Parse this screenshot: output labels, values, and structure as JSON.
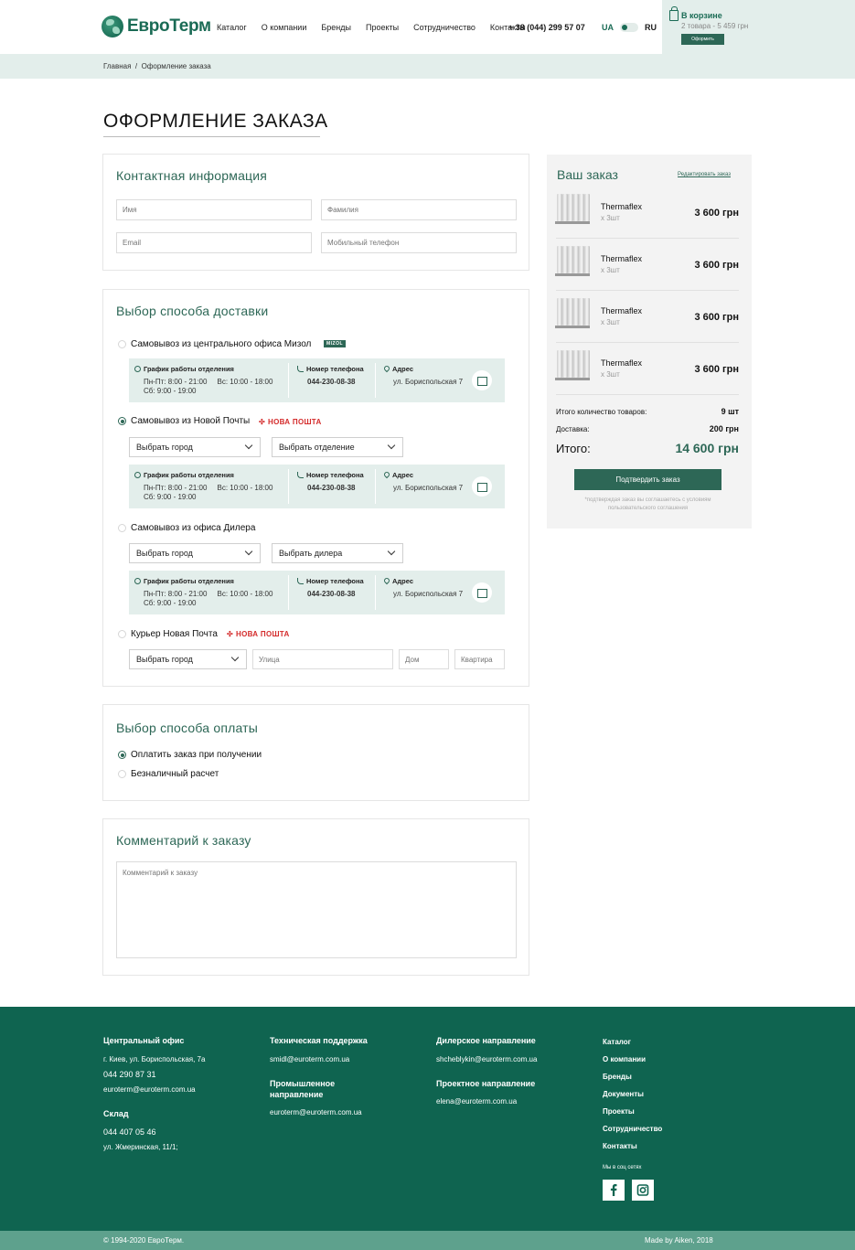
{
  "header": {
    "logo": "ЕвроТерм",
    "nav": [
      "Каталог",
      "О компании",
      "Бренды",
      "Проекты",
      "Сотрудничество",
      "Контакты"
    ],
    "phone": "+ 38 (044) 299 57 07",
    "lang_ua": "UA",
    "lang_ru": "RU",
    "cart": {
      "title": "В корзине",
      "subtitle": "2 товара - 5 459 грн",
      "button": "Оформить"
    }
  },
  "breadcrumb": {
    "home": "Главная",
    "sep": "/",
    "current": "Оформление заказа"
  },
  "page_title": "ОФОРМЛЕНИЕ ЗАКАЗА",
  "contact": {
    "title": "Контактная информация",
    "first_name": "Имя",
    "last_name": "Фамилия",
    "email": "Email",
    "phone": "Мобильный телефон"
  },
  "delivery": {
    "title": "Выбор способа доставки",
    "options": [
      {
        "label": "Самовывоз из центрального офиса Мизол",
        "badge": "MIZOL",
        "checked": false
      },
      {
        "label": "Самовывоз из Новой Почты",
        "badge": "НОВА ПОШТА",
        "checked": true,
        "select1": "Выбрать город",
        "select2": "Выбрать отделение"
      },
      {
        "label": "Самовывоз из офиса Дилера",
        "checked": false,
        "select1": "Выбрать город",
        "select2": "Выбрать дилера"
      },
      {
        "label": "Курьер Новая Почта",
        "badge": "НОВА ПОШТА",
        "checked": false,
        "select1": "Выбрать город",
        "street": "Улица",
        "house": "Дом",
        "apt": "Квартира"
      }
    ],
    "info": {
      "hours_h": "График работы отделения",
      "hours_1": "Пн-Пт: 8:00 - 21:00",
      "hours_2": "Вс: 10:00 - 18:00",
      "hours_3": "Сб: 9:00 - 19:00",
      "phone_h": "Номер телефона",
      "phone_v": "044-230-08-38",
      "addr_h": "Адрес",
      "addr_v": "ул. Бориспольская 7"
    }
  },
  "payment": {
    "title": "Выбор способа оплаты",
    "opt1": "Оплатить заказ при получении",
    "opt2": "Безналичный расчет"
  },
  "comment": {
    "title": "Комментарий к заказу",
    "placeholder": "Комментарий к заказу"
  },
  "order": {
    "title": "Ваш заказ",
    "edit": "Редактировать заказ",
    "items": [
      {
        "name": "Thermaflex",
        "qty": "x 3шт",
        "price": "3 600 грн"
      },
      {
        "name": "Thermaflex",
        "qty": "x 3шт",
        "price": "3 600 грн"
      },
      {
        "name": "Thermaflex",
        "qty": "x 3шт",
        "price": "3 600 грн"
      },
      {
        "name": "Thermaflex",
        "qty": "x 3шт",
        "price": "3 600 грн"
      }
    ],
    "count_l": "Итого количество товаров:",
    "count_v": "9 шт",
    "delivery_l": "Доставка:",
    "delivery_v": "200 грн",
    "total_l": "Итого:",
    "total_v": "14 600 грн",
    "confirm": "Подтвердить заказ",
    "note": "*подтверждая заказ вы соглашаетесь с условиям пользовательского соглашения"
  },
  "footer": {
    "office_h": "Центральный офис",
    "office_addr": "г. Киев, ул. Бориспольская, 7а",
    "office_phone": "044 290 87 31",
    "office_mail": "euroterm@euroterm.com.ua",
    "store_h": "Склад",
    "store_phone": "044 407 05 46",
    "store_addr": "ул. Жмеринская, 11/1;",
    "tech_h": "Техническая поддержка",
    "tech_mail": "smidl@euroterm.com.ua",
    "ind_h1": "Промышленное",
    "ind_h2": "направление",
    "ind_mail": "euroterm@euroterm.com.ua",
    "dealer_h": "Дилерское направление",
    "dealer_mail": "shcheblykin@euroterm.com.ua",
    "proj_h": "Проектное направление",
    "proj_mail": "elena@euroterm.com.ua",
    "nav": [
      "Каталог",
      "О компании",
      "Бренды",
      "Документы",
      "Проекты",
      "Сотрудничество",
      "Контакты"
    ],
    "social_h": "Мы в соц сетях",
    "copyright": "© 1994-2020 ЕвроТерм.",
    "made": "Made by Aiken, 2018"
  }
}
